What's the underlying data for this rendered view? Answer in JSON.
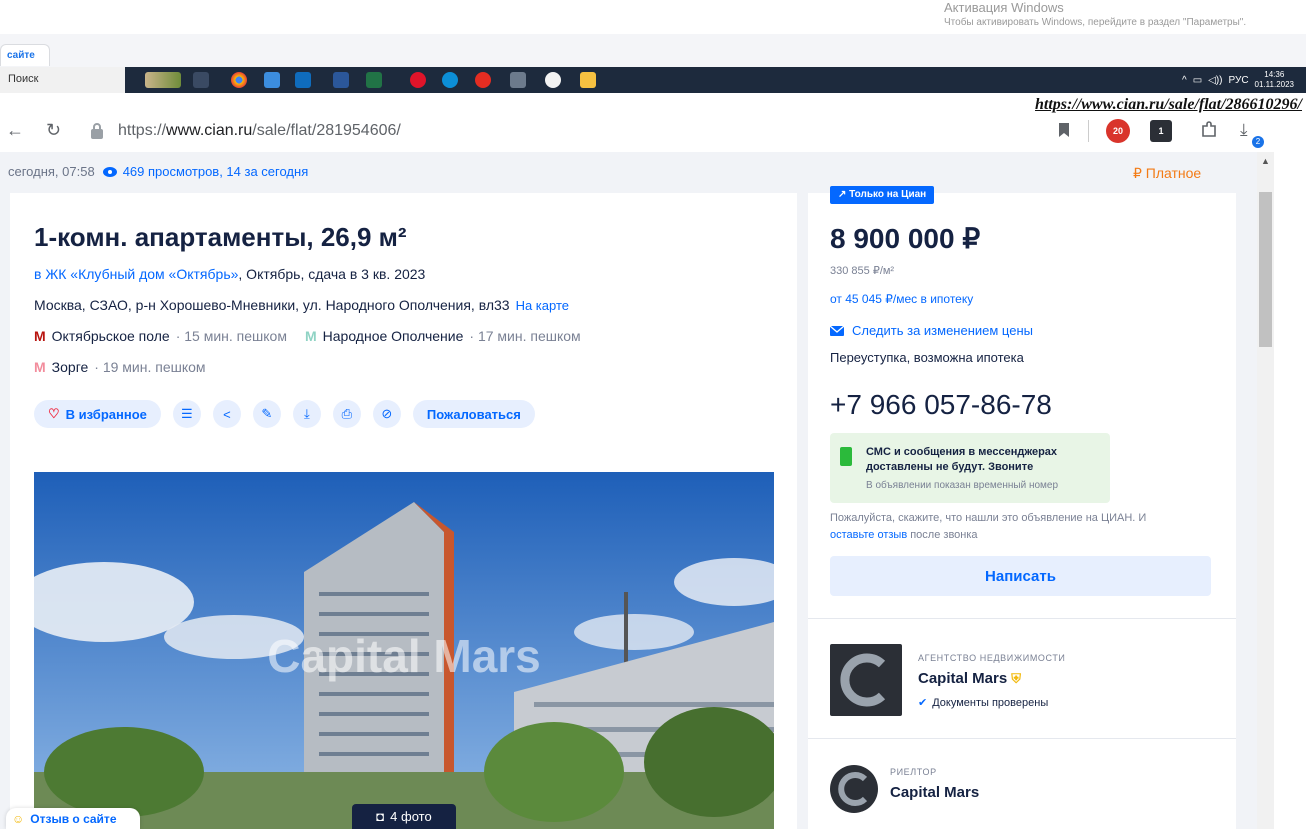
{
  "windows_activation": {
    "title": "Активация Windows",
    "subtitle": "Чтобы активировать Windows, перейдите в раздел \"Параметры\"."
  },
  "browser_tab": {
    "label": "сайте"
  },
  "taskbar": {
    "search_placeholder": "Поиск",
    "tray_lang": "РУС",
    "time": "14:36",
    "date": "01.11.2023"
  },
  "annotation_url": "https://www.cian.ru/sale/flat/286610296/",
  "addressbar": {
    "url_prefix": "https://",
    "url_domain": "www.cian.ru",
    "url_path": "/sale/flat/281954606/",
    "ext_badge_1": "20",
    "ext_badge_2": "1",
    "download_badge": "2"
  },
  "listing": {
    "published": "сегодня, 07:58",
    "views": "469 просмотров, 14 за сегодня",
    "paid_label": "Платное",
    "title": "1-комн. апартаменты, 26,9 м²",
    "jk_link": "в ЖК «Клубный дом «Октябрь»",
    "jk_rest": ", Октябрь, сдача в 3 кв. 2023",
    "address": "Москва, СЗАО, р-н Хорошево-Мневники, ул. Народного Ополчения, вл33",
    "map_link": "На карте",
    "metro": [
      {
        "name": "Октябрьское поле",
        "dist": "· 15 мин. пешком",
        "color": "#b8140f"
      },
      {
        "name": "Народное Ополчение",
        "dist": "· 17 мин. пешком",
        "color": "#8fd3c4"
      },
      {
        "name": "Зорге",
        "dist": "· 19 мин. пешком",
        "color": "#f28c9c"
      }
    ],
    "favorite_label": "В избранное",
    "complain_label": "Пожаловаться",
    "photo_watermark": "Capital Mars",
    "photo_count": "4 фото",
    "site_feedback": "Отзыв о сайте"
  },
  "sidebar": {
    "exclusive_badge": "Только на Циан",
    "price": "8 900 000 ₽",
    "price_per_m2": "330 855 ₽/м²",
    "mortgage": "от 45 045 ₽/мес в ипотеку",
    "track_price": "Следить за изменением цены",
    "deal_type": "Переуступка, возможна ипотека",
    "phone": "+7 966 057-86-78",
    "sms_title": "СМС и сообщения в мессенджерах доставлены не будут. Звоните",
    "sms_sub": "В объявлении показан временный номер",
    "ask_note": "Пожалуйста, скажите, что нашли это объявление на ЦИАН. И",
    "review_link": "оставьте отзыв",
    "ask_note_end": " после звонка",
    "write_button": "Написать",
    "agency_kind": "АГЕНТСТВО НЕДВИЖИМОСТИ",
    "agency_name": "Capital Mars",
    "docs_checked": "Документы проверены",
    "realtor_kind": "РИЕЛТОР",
    "realtor_name": "Capital Mars"
  }
}
